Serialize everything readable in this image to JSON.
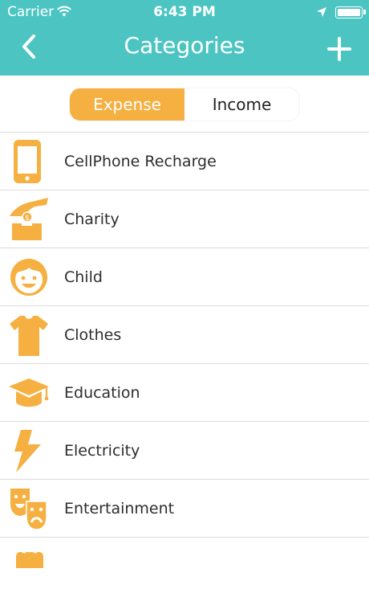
{
  "status": {
    "carrier": "Carrier",
    "time": "6:43 PM"
  },
  "nav": {
    "title": "Categories",
    "back_icon": "chevron-left-icon",
    "add_icon": "plus-icon"
  },
  "segment": {
    "expense": "Expense",
    "income": "Income",
    "selected": "Expense"
  },
  "categories": [
    {
      "label": "CellPhone Recharge",
      "icon": "cellphone-icon"
    },
    {
      "label": "Charity",
      "icon": "charity-icon"
    },
    {
      "label": "Child",
      "icon": "child-icon"
    },
    {
      "label": "Clothes",
      "icon": "clothes-icon"
    },
    {
      "label": "Education",
      "icon": "education-icon"
    },
    {
      "label": "Electricity",
      "icon": "electricity-icon"
    },
    {
      "label": "Entertainment",
      "icon": "entertainment-icon"
    }
  ],
  "colors": {
    "header": "#4cc5c2",
    "accent": "#f5b041",
    "divider": "#dcdcdc"
  }
}
